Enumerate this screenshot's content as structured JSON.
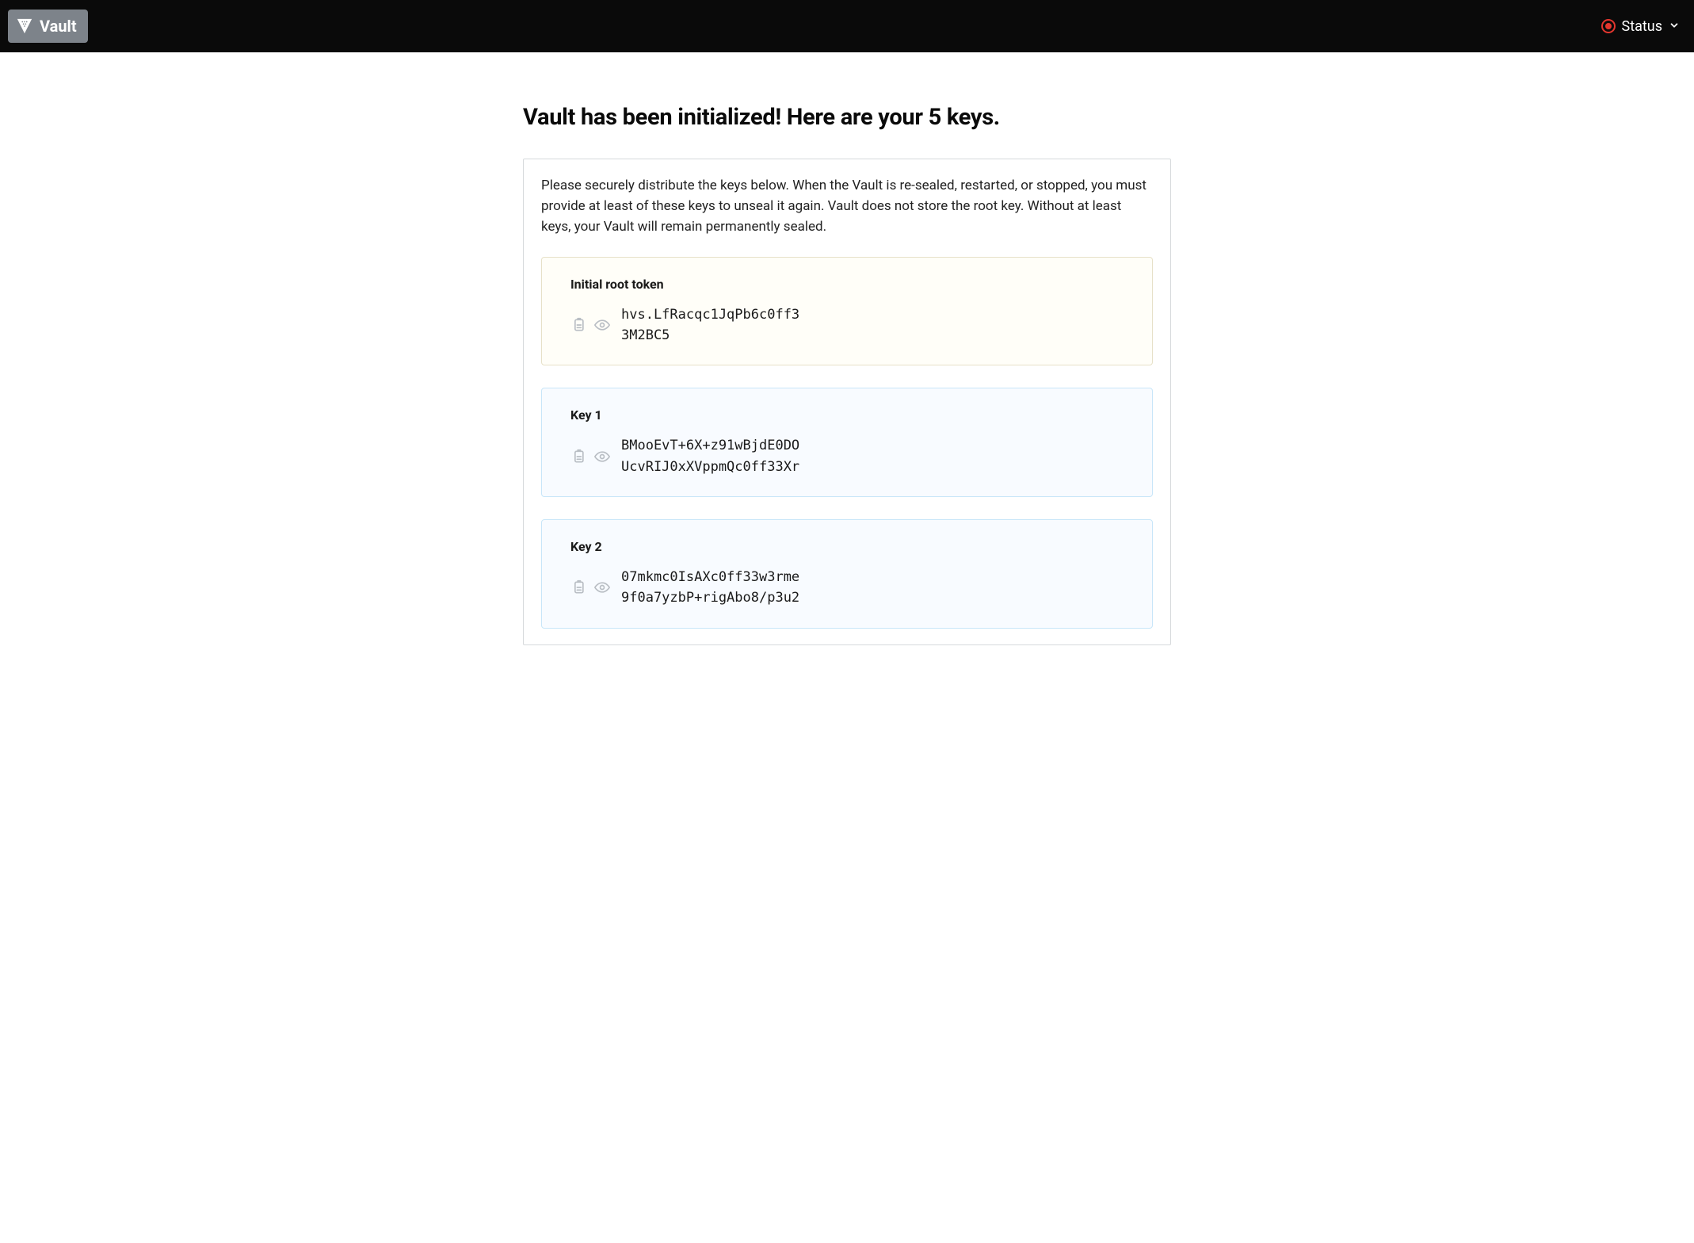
{
  "header": {
    "app_name": "Vault",
    "status_label": "Status"
  },
  "page": {
    "title": "Vault has been initialized! Here are your 5 keys.",
    "instructions": "Please securely distribute the keys below. When the Vault is re-sealed, restarted, or stopped, you must provide at least of these keys to unseal it again. Vault does not store the root key. Without at least keys, your Vault will remain permanently sealed."
  },
  "root_token": {
    "label": "Initial root token",
    "value": "hvs.LfRacqc1JqPb6c0ff33M2BC5"
  },
  "keys": [
    {
      "label": "Key 1",
      "value": "BMooEvT+6X+z91wBjdE0DOUcvRIJ0xXVppmQc0ff33Xr"
    },
    {
      "label": "Key 2",
      "value": "07mkmc0IsAXc0ff33w3rme9f0a7yzbP+rigAbo8/p3u2"
    }
  ]
}
